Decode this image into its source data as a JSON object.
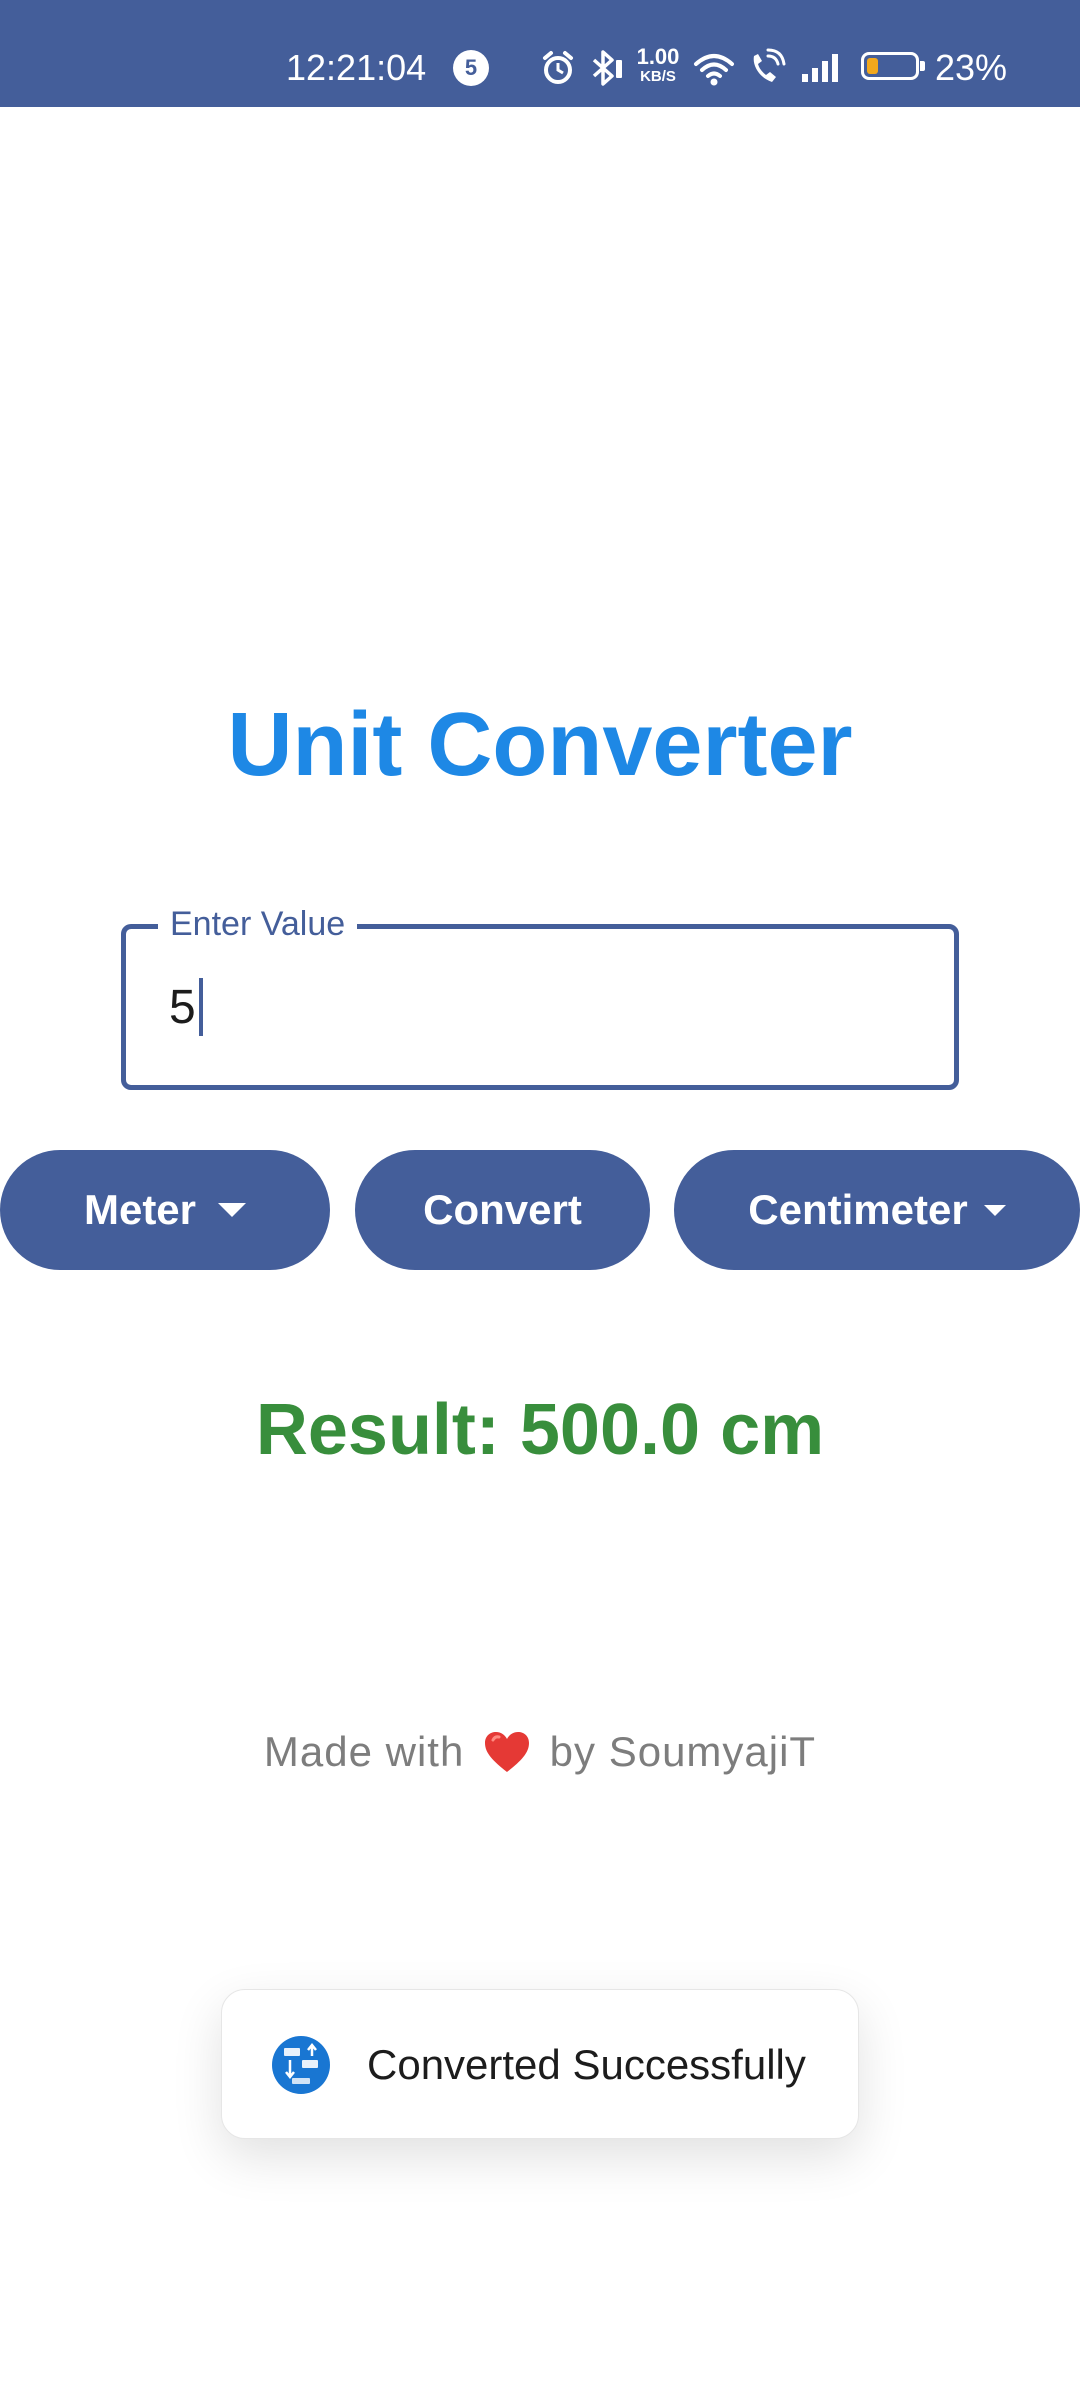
{
  "status_bar": {
    "time": "12:21:04",
    "notification_count": "5",
    "net_speed_value": "1.00",
    "net_speed_unit": "KB/S",
    "battery_percent": "23%",
    "battery_level": 0.23,
    "bg_color": "#445e9a",
    "icons": [
      "alarm-icon",
      "bluetooth-icon",
      "wifi-icon",
      "wifi-call-icon",
      "signal-icon",
      "battery-icon"
    ]
  },
  "app": {
    "title": "Unit Converter",
    "title_color": "#1e88e5"
  },
  "input": {
    "label": "Enter Value",
    "value": "5"
  },
  "controls": {
    "from_unit": "Meter",
    "convert_label": "Convert",
    "to_unit": "Centimeter",
    "accent_color": "#445e9a"
  },
  "result": {
    "text": "Result: 500.0 cm",
    "color": "#388e3c"
  },
  "footer": {
    "prefix": "Made with",
    "suffix": "by SoumyajiT",
    "icon": "heart-icon"
  },
  "toast": {
    "message": "Converted Successfully",
    "icon": "unit-converter-app-icon"
  }
}
